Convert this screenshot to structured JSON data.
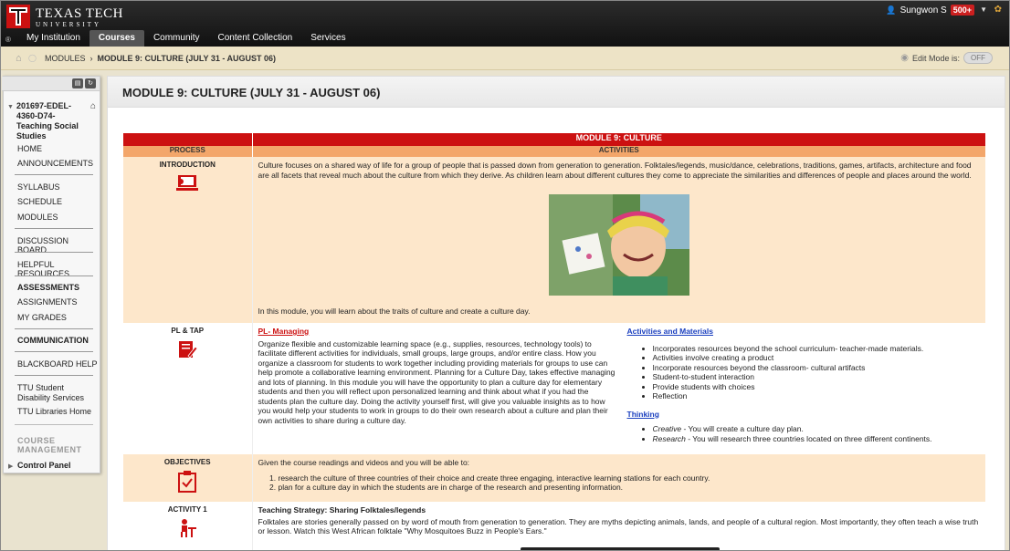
{
  "header": {
    "university": "TEXAS TECH",
    "university_sub": "UNIVERSITY",
    "registered": "®",
    "user_name": "Sungwon S",
    "notifications": "500+",
    "tabs": [
      "My Institution",
      "Courses",
      "Community",
      "Content Collection",
      "Services"
    ],
    "active_tab": "Courses"
  },
  "breadcrumb": {
    "items": [
      "MODULES",
      "MODULE 9: CULTURE (JULY 31 - AUGUST 06)"
    ],
    "edit_mode_label": "Edit Mode is:",
    "edit_mode_value": "OFF"
  },
  "sidebar": {
    "course_title": "201697-EDEL-4360-D74-Teaching Social Studies",
    "items": [
      "HOME",
      "ANNOUNCEMENTS",
      "SYLLABUS",
      "SCHEDULE",
      "MODULES",
      "DISCUSSION BOARD",
      "HELPFUL RESOURCES",
      "ASSESSMENTS",
      "ASSIGNMENTS",
      "MY GRADES",
      "COMMUNICATION",
      "BLACKBOARD HELP",
      "TTU Student Disability Services",
      "TTU Libraries Home"
    ],
    "management_label": "COURSE MANAGEMENT",
    "control_panel": "Control Panel"
  },
  "page": {
    "title": "MODULE 9: CULTURE (JULY 31 - AUGUST 06)"
  },
  "module": {
    "banner": "MODULE 9: CULTURE",
    "col_process": "PROCESS",
    "col_activities": "ACTIVITIES",
    "intro": {
      "label": "INTRODUCTION",
      "text": "Culture focuses on a shared way of life for a group of people that is passed down from generation to generation. Folktales/legends, music/dance, celebrations, traditions, games, artifacts, architecture and food are all facets that reveal much about the culture from which they derive. As children learn about different cultures they come to appreciate the similarities and differences of people and places around the world.",
      "closing": "In this module, you will learn about the traits of culture and create a culture day."
    },
    "pltap": {
      "label": "PL & TAP",
      "link": "PL- Managing",
      "text": "Organize flexible and customizable learning space (e.g., supplies, resources, technology tools) to facilitate different activities for individuals, small groups, large groups, and/or entire class. How you organize a classroom for students to work together including providing materials for groups to use can help promote a collaborative learning environment. Planning for a Culture Day, takes effective managing and lots of planning.  In this module you will have the opportunity to plan a culture day for elementary students and then you will reflect upon personalized learning and think about what if you had the students plan the culture day.  Doing the activity yourself first, will give you valuable insights as to how you would help your students to work in groups to do their own research about a culture and plan their own activities to share during a culture day.",
      "materials_title": "Activities and Materials",
      "materials": [
        "Incorporates resources beyond the school curriculum- teacher-made materials.",
        "Activities involve creating a product",
        "Incorporate resources beyond the classroom- cultural artifacts",
        "Student-to-student interaction",
        "Provide students with choices",
        "Reflection"
      ],
      "thinking_title": "Thinking",
      "thinking": [
        {
          "term": "Creative",
          "text": " - You will create a culture day plan."
        },
        {
          "term": "Research",
          "text": " - You will research three countries located on three different continents."
        }
      ]
    },
    "objectives": {
      "label": "OBJECTIVES",
      "intro": "Given the course readings and videos and you will be able to:",
      "items": [
        "research the culture of three countries of their choice and create three engaging, interactive learning stations for each country.",
        "plan for a culture day in which the students are in charge of the research and presenting information."
      ]
    },
    "activity1": {
      "label": "ACTIVITY 1",
      "heading": "Teaching Strategy: Sharing Folktales/legends",
      "text": "Folktales are stories generally passed on by word of mouth from generation to generation.  They are myths depicting animals, lands, and people of a cultural region. Most importantly, they often teach a wise truth or lesson.  Watch this West African folktale \"Why Mosquitoes Buzz in People's Ears.\""
    }
  },
  "colors": {
    "accent_red": "#cc1111",
    "orange": "#f3a66a",
    "peach": "#fde7cb",
    "link_blue": "#1a3fbf"
  }
}
